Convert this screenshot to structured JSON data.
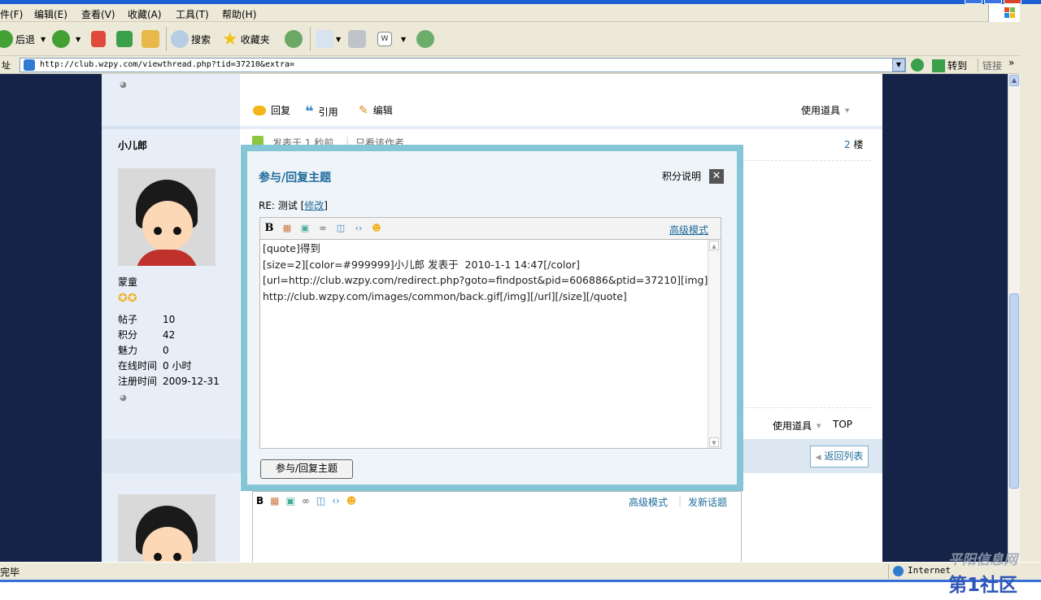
{
  "menubar": {
    "items": [
      "件(F)",
      "编辑(E)",
      "查看(V)",
      "收藏(A)",
      "工具(T)",
      "帮助(H)"
    ]
  },
  "toolbar": {
    "back": "后退",
    "search": "搜索",
    "favorites": "收藏夹"
  },
  "address": {
    "url": "http://club.wzpy.com/viewthread.php?tid=37210&extra=",
    "go": "转到",
    "links": "链接"
  },
  "post_actions": {
    "reply": "回复",
    "quote": "引用",
    "edit": "编辑",
    "tools": "使用道具"
  },
  "post2": {
    "username": "小儿郎",
    "posted": "发表于 1 秒前",
    "only_author": "只看该作者",
    "floor_num": "2",
    "floor_unit": "楼",
    "rank": "蒙童",
    "stats": [
      {
        "k": "帖子",
        "v": "10"
      },
      {
        "k": "积分",
        "v": "42"
      },
      {
        "k": "魅力",
        "v": "0"
      },
      {
        "k": "在线时间",
        "v": "0 小时"
      },
      {
        "k": "注册时间",
        "v": "2009-12-31"
      }
    ],
    "tools": "使用道具",
    "top": "TOP"
  },
  "back_list": "返回列表",
  "quick_reply": {
    "advanced": "高级模式",
    "new_topic": "发新话题"
  },
  "modal": {
    "title": "参与/回复主题",
    "help": "积分说明",
    "subject_prefix": "RE: 测试",
    "modify": "修改",
    "advanced": "高级模式",
    "body": "[quote]得到\n[size=2][color=#999999]小儿郎 发表于  2010-1-1 14:47[/color]\n[url=http://club.wzpy.com/redirect.php?goto=findpost&pid=606886&ptid=37210][img]\nhttp://club.wzpy.com/images/common/back.gif[/img][/url][/size][/quote]",
    "submit": "参与/回复主题"
  },
  "status": {
    "left": "完毕",
    "zone": "Internet"
  },
  "watermark": {
    "line1": "平阳信息网",
    "line2": "第1社区"
  }
}
